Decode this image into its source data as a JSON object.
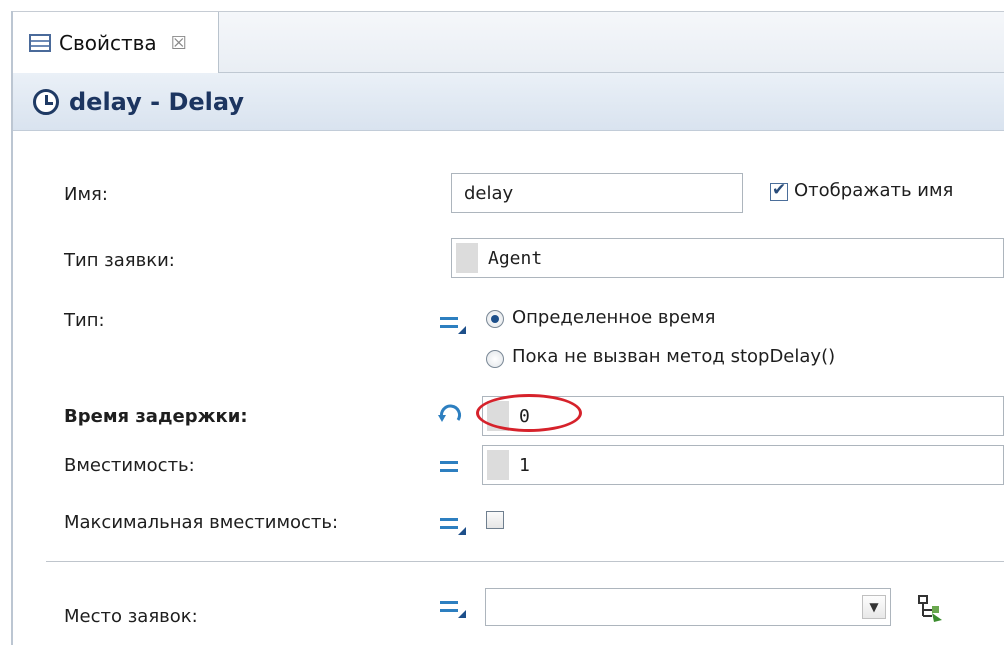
{
  "tab": {
    "label": "Свойства",
    "close_glyph": "☒"
  },
  "header": {
    "title": "delay - Delay",
    "icon": "clock-icon"
  },
  "fields": {
    "name": {
      "label": "Имя:",
      "value": "delay",
      "show_name_label": "Отображать имя",
      "show_name_checked": true
    },
    "agent_type": {
      "label": "Тип заявки:",
      "value": "Agent"
    },
    "type": {
      "label": "Тип:",
      "options": [
        "Определенное время",
        "Пока не вызван метод stopDelay()"
      ],
      "selected": "Определенное время"
    },
    "delay_time": {
      "label": "Время задержки:",
      "value": "0"
    },
    "capacity": {
      "label": "Вместимость:",
      "value": "1"
    },
    "max_capacity": {
      "label": "Максимальная вместимость:",
      "checked": false
    },
    "agent_location": {
      "label": "Место заявок:",
      "value": ""
    }
  },
  "colors": {
    "accent_blue": "#2d7fc0",
    "header_text": "#1c3560",
    "highlight_red": "#d6222b"
  }
}
